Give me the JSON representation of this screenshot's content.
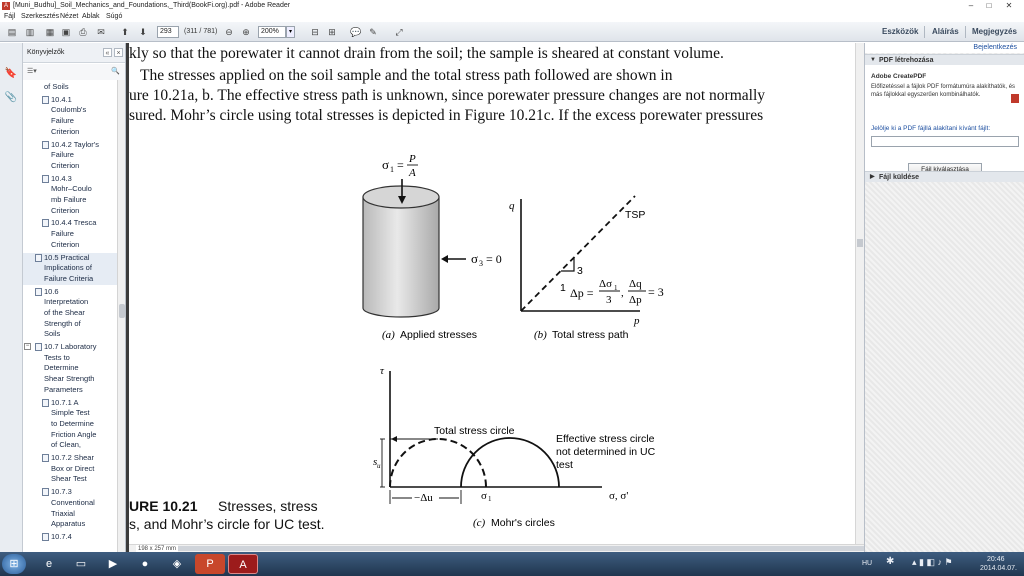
{
  "window": {
    "title": "[Muni_Budhu]_Soil_Mechanics_and_Foundations,_Third(BookFi.org).pdf - Adobe Reader",
    "minimize": "–",
    "maximize": "□",
    "close": "✕"
  },
  "menu": [
    "Fájl",
    "Szerkesztés",
    "Nézet",
    "Ablak",
    "Súgó"
  ],
  "toolbar": {
    "page_value": "293",
    "page_count": "(311 / 781)",
    "zoom_value": "200%",
    "tools_label": "Eszközök",
    "sign_label": "Aláírás",
    "comment_label": "Megjegyzés"
  },
  "bookmarks": {
    "header": "Könyvjelzők",
    "items": [
      {
        "label": "of Soils",
        "level": 1
      },
      {
        "label": "10.4.1 Coulomb's Failure Criterion",
        "level": 2,
        "lines": [
          "10.4.1",
          "Coulomb's",
          "Failure",
          "Criterion"
        ]
      },
      {
        "label": "10.4.2 Taylor's Failure Criterion",
        "level": 2,
        "lines": [
          "10.4.2 Taylor's",
          "Failure",
          "Criterion"
        ]
      },
      {
        "label": "10.4.3 Mohr–Coulomb Failure Criterion",
        "level": 2,
        "lines": [
          "10.4.3",
          "Mohr–Coulo",
          "mb Failure",
          "Criterion"
        ]
      },
      {
        "label": "10.4.4 Tresca Failure Criterion",
        "level": 2,
        "lines": [
          "10.4.4 Tresca",
          "Failure",
          "Criterion"
        ]
      },
      {
        "label": "10.5 Practical Implications of Failure Criteria",
        "level": 1,
        "lines": [
          "10.5 Practical",
          "Implications of",
          "Failure Criteria"
        ],
        "selected": true
      },
      {
        "label": "10.6 Interpretation of the Shear Strength of Soils",
        "level": 1,
        "lines": [
          "10.6",
          "Interpretation",
          "of the Shear",
          "Strength of",
          "Soils"
        ]
      },
      {
        "label": "10.7 Laboratory Tests to Determine Shear Strength Parameters",
        "level": 1,
        "lines": [
          "10.7 Laboratory",
          "Tests to",
          "Determine",
          "Shear Strength",
          "Parameters"
        ],
        "expanded": true
      },
      {
        "label": "10.7.1 A Simple Test to Determine Friction Angle of Clean,",
        "level": 2,
        "lines": [
          "10.7.1 A",
          "Simple Test",
          "to Determine",
          "Friction Angle",
          "of Clean,"
        ]
      },
      {
        "label": "10.7.2 Shear Box or Direct Shear Test",
        "level": 2,
        "lines": [
          "10.7.2 Shear",
          "Box or Direct",
          "Shear Test"
        ]
      },
      {
        "label": "10.7.3 Conventional Triaxial Apparatus",
        "level": 2,
        "lines": [
          "10.7.3",
          "Conventional",
          "Triaxial",
          "Apparatus"
        ]
      },
      {
        "label": "10.7.4",
        "level": 2,
        "lines": [
          "10.7.4"
        ]
      }
    ]
  },
  "document": {
    "line1": "kly so that the porewater it cannot drain from the soil; the sample is sheared at constant volume.",
    "line2": "The stresses applied on the soil sample and the total stress path followed are shown in",
    "line3": "ure 10.21a, b. The effective stress path is unknown, since porewater pressure changes are not normally",
    "line4": "sured. Mohr’s circle using total stresses is depicted in Figure 10.21c. If the excess porewater pressures",
    "fig_a": {
      "sigma1_label": "σ",
      "sigma1_sub": "1",
      "eq": "=",
      "P": "P",
      "A": "A",
      "sigma3_label": "σ",
      "sigma3_sub": "3",
      "sigma3_value": "= 0",
      "caption_letter": "(a)",
      "caption": "Applied stresses"
    },
    "fig_b": {
      "q_label": "q",
      "p_label": "p",
      "tsp_label": "TSP",
      "slope_rise": "3",
      "slope_run": "1",
      "delta_p": "Δp =",
      "frac1_num": "Δσ",
      "frac1_num_sub": "1",
      "frac1_den": "3",
      "comma": ",",
      "frac2_num": "Δq",
      "frac2_den": "Δp",
      "frac2_value": "= 3",
      "caption_letter": "(b)",
      "caption": "Total stress path"
    },
    "fig_c": {
      "tau_label": "τ",
      "su_label": "s",
      "su_sub": "u",
      "total_label": "Total stress circle",
      "effective_label": "Effective stress circle",
      "effective_line2": "not determined in UC",
      "effective_line3": "test",
      "du_label": "−Δu",
      "sigma1_label": "σ",
      "sigma1_sub": "1",
      "xaxis_label": "σ, σ'",
      "caption_letter": "(c)",
      "caption": "Mohr's circles"
    },
    "fig_title": "URE 10.21",
    "fig_desc1": "Stresses, stress",
    "fig_desc2": "s, and Mohr’s circle for UC test."
  },
  "status": {
    "page_size": "198 x 257 mm"
  },
  "right_pane": {
    "signin": "Bejelentkezés",
    "section1": "PDF létrehozása",
    "product": "Adobe CreatePDF",
    "desc1": "Előfizetéssel a fájlok PDF formátumúra alakíthatók, és",
    "desc2": "más fájlokkal egyszerűen kombinálhatók.",
    "select_label": "Jelölje ki a PDF fájllá alakítani kívánt fájlt:",
    "choose_button": "Fájl kiválasztása",
    "section2": "Fájl küldése"
  },
  "taskbar": {
    "lang": "HU",
    "time": "20:46",
    "date": "2014.04.07."
  }
}
